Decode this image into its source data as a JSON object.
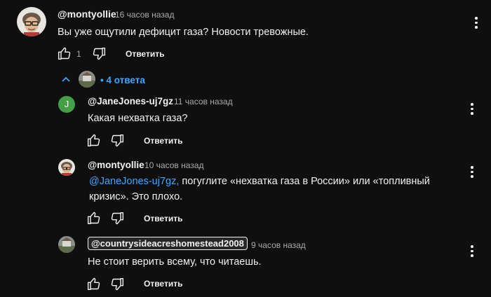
{
  "comment": {
    "author": "@montyollie",
    "time": "16 часов назад",
    "text": "Вы уже ощутили дефицит газа? Новости тревожные.",
    "likes": "1",
    "reply_label": "Ответить"
  },
  "replies_toggle": {
    "dot": "•",
    "label": "4 ответа"
  },
  "replies": [
    {
      "avatar_letter": "J",
      "avatar_color": "#43a047",
      "author": "@JaneJones-uj7gz",
      "time": "11 часов назад",
      "text": "Какая нехватка газа?",
      "reply_label": "Ответить"
    },
    {
      "author": "@montyollie",
      "time": "10 часов назад",
      "mention": "@JaneJones-uj7gz,",
      "text": " погуглите «нехватка газа в России» или «топливный кризис». Это плохо.",
      "reply_label": "Ответить"
    },
    {
      "author": "@countrysideacreshomestead2008",
      "time": "9 часов назад",
      "text": "Не стоит верить всему, что читаешь.",
      "reply_label": "Ответить"
    }
  ],
  "colors": {
    "background": "#0f0f0f",
    "text": "#f1f1f1",
    "secondary": "#aaaaaa",
    "link": "#3ea6ff"
  }
}
